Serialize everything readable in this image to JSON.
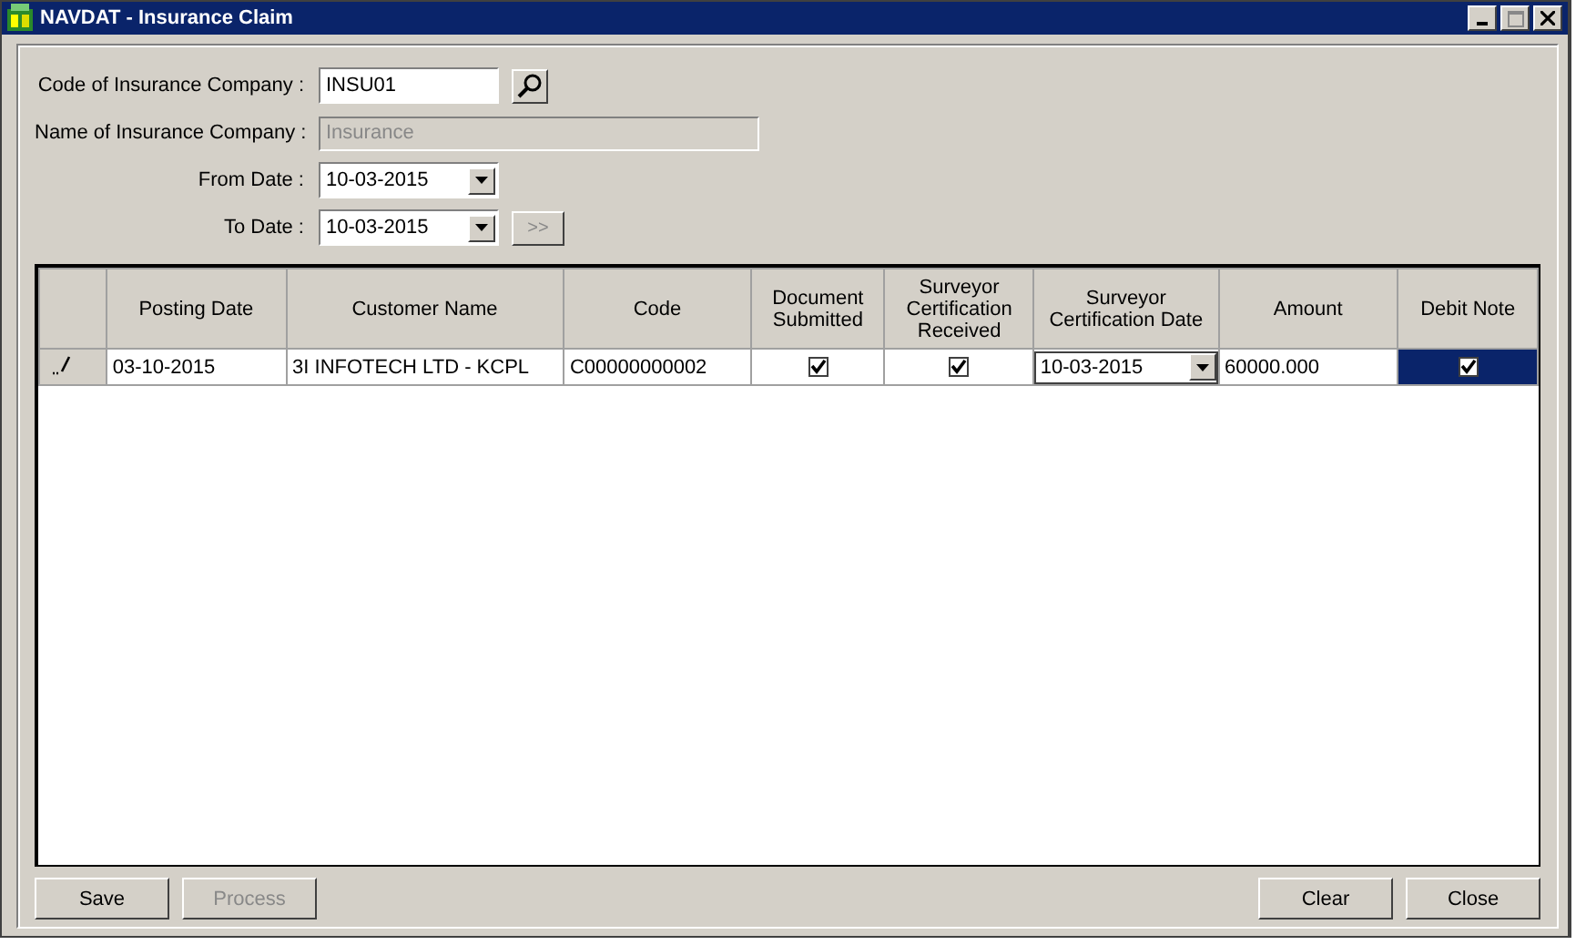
{
  "window": {
    "title": "NAVDAT - Insurance Claim"
  },
  "form": [
    {
      "kind": "lookup",
      "label": "Code of Insurance Company :",
      "value": "INSU01",
      "disabled": false
    },
    {
      "kind": "text",
      "label": "Name of Insurance Company :",
      "value": "Insurance",
      "disabled": true
    },
    {
      "kind": "date",
      "label": "From Date :",
      "value": "10-03-2015",
      "disabled": false
    },
    {
      "kind": "date-go",
      "label": "To Date :",
      "value": "10-03-2015",
      "disabled": false,
      "go_label": ">>"
    }
  ],
  "table": {
    "columns": [
      "Posting Date",
      "Customer Name",
      "Code",
      "Document Submitted",
      "Surveyor Certification Received",
      "Surveyor Certification Date",
      "Amount",
      "Debit Note"
    ],
    "rows": [
      {
        "editing": true,
        "cells": [
          {
            "kind": "text",
            "value": "03-10-2015",
            "selected": false
          },
          {
            "kind": "text",
            "value": "3I INFOTECH LTD - KCPL",
            "selected": false
          },
          {
            "kind": "text",
            "value": "C00000000002",
            "selected": false
          },
          {
            "kind": "check",
            "checked": true,
            "selected": false
          },
          {
            "kind": "check",
            "checked": true,
            "selected": false
          },
          {
            "kind": "date",
            "value": "10-03-2015",
            "selected": false
          },
          {
            "kind": "text",
            "value": "60000.000",
            "selected": false
          },
          {
            "kind": "check",
            "checked": true,
            "selected": true
          }
        ]
      }
    ]
  },
  "buttons": [
    {
      "label": "Save",
      "disabled": false
    },
    {
      "label": "Process",
      "disabled": true
    },
    {
      "label": "Clear",
      "disabled": false
    },
    {
      "label": "Close",
      "disabled": false
    }
  ]
}
